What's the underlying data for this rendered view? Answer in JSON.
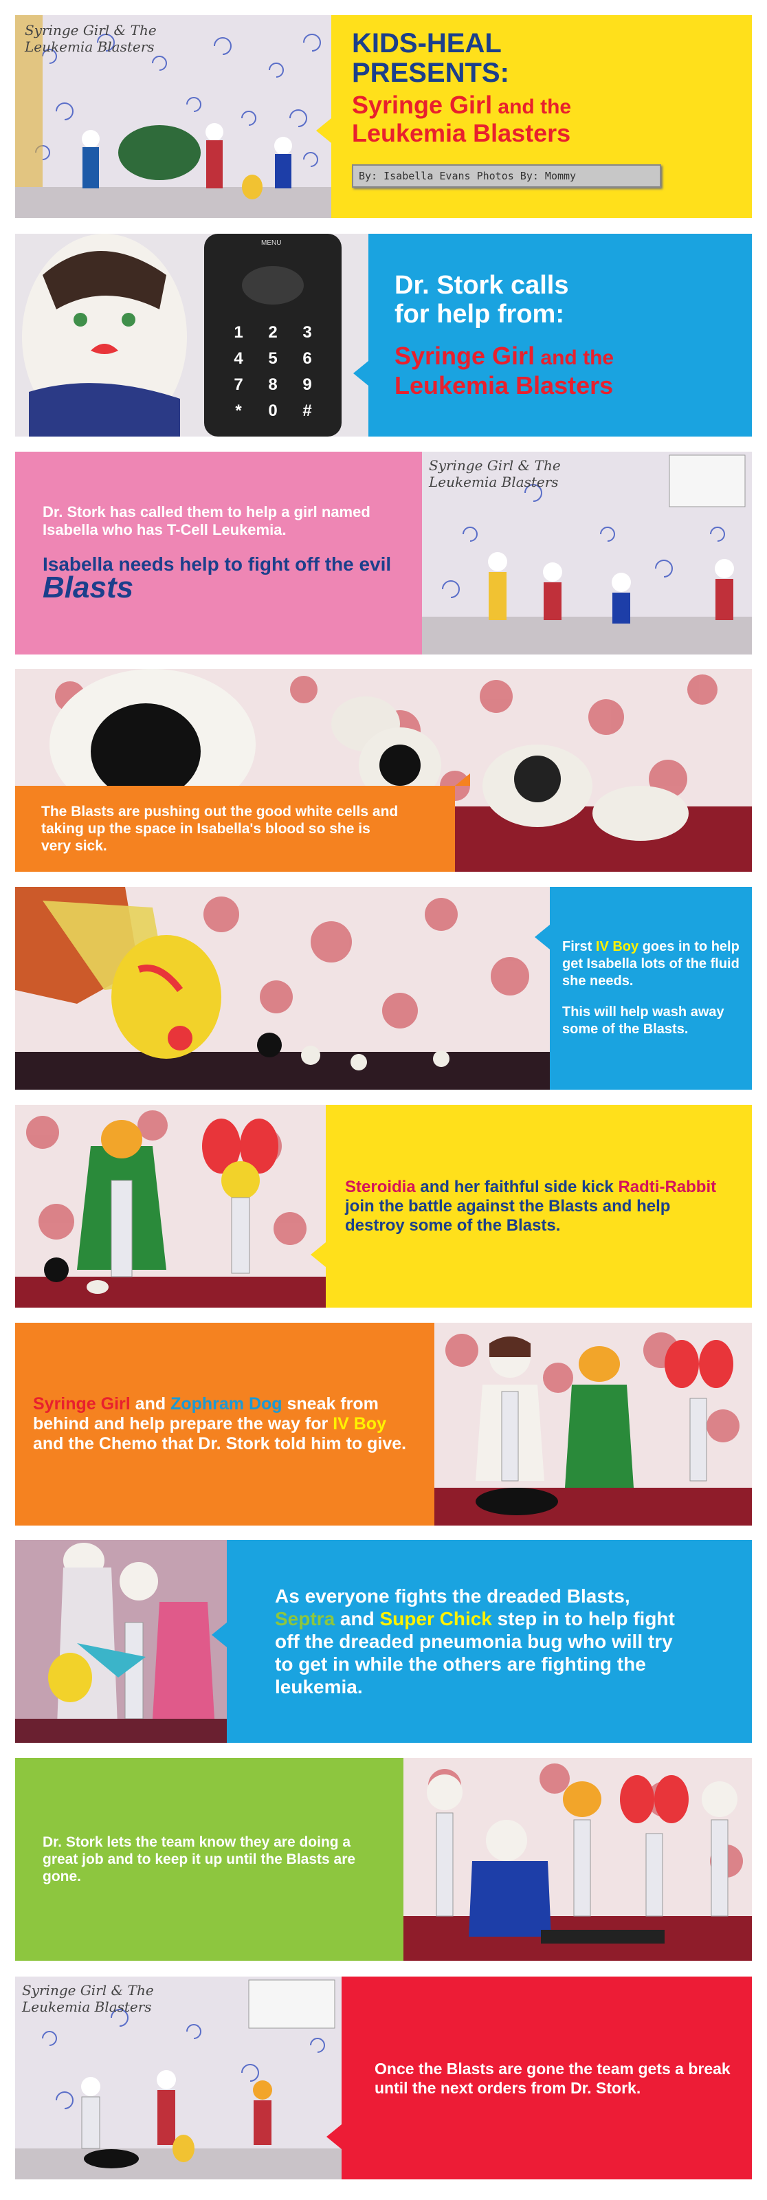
{
  "colors": {
    "yellow": "#ffe01b",
    "blue": "#1aa3e0",
    "pink": "#ee86b4",
    "orange": "#f58220",
    "green": "#8dc63f",
    "red": "#ed1c36",
    "navy": "#1b3f8b"
  },
  "panel1": {
    "title_line1": "KIDS-HEAL",
    "title_line2": "PRESENTS:",
    "subtitle_a": "Syringe Girl",
    "subtitle_b": " and the",
    "subtitle_c": "Leukemia Blasters",
    "byline": "By: Isabella Evans Photos By: Mommy",
    "photo_text": "Syringe Girl & The Leukemia Blasters"
  },
  "panel2": {
    "line1": "Dr. Stork calls",
    "line2": "for help from:",
    "name_a": "Syringe Girl",
    "name_b": " and the",
    "name_c": "Leukemia Blasters",
    "phone_menu": "MENU",
    "phone_keys": [
      "1",
      "2",
      "3",
      "4",
      "5",
      "6",
      "7",
      "8",
      "9",
      "*",
      "0",
      "#"
    ]
  },
  "panel3": {
    "text": "Dr. Stork has called them to help a girl named Isabella who has T-Cell Leukemia.",
    "text2": "Isabella needs help to fight off the evil",
    "blasts": "Blasts",
    "photo_text": "Syringe Girl & The Leukemia Blasters"
  },
  "panel4": {
    "text": "The Blasts are pushing out the good white cells and taking up the space in Isabella's blood so she is very sick."
  },
  "panel5": {
    "text_a": "First ",
    "text_hl": "IV Boy",
    "text_b": " goes in to help get Isabella lots of the fluid she needs.",
    "text2": "This will help wash away some of the Blasts."
  },
  "panel6": {
    "hl1": "Steroidia",
    "text_a": " and her faithful side kick ",
    "hl2": "Radti-Rabbit",
    "text_b": " join the battle against the Blasts and help destroy some of the Blasts."
  },
  "panel7": {
    "hl1": "Syringe Girl",
    "text_a": " and ",
    "hl2": "Zophram Dog",
    "text_b": " sneak from behind and help prepare the way for ",
    "hl3": "IV Boy",
    "text_c": " and the Chemo that Dr. Stork told him to give."
  },
  "panel8": {
    "text_a": "As everyone fights the dreaded Blasts, ",
    "hl1": "Septra",
    "text_b": " and ",
    "hl2": "Super Chick",
    "text_c": " step in to help fight off the dreaded pneumonia bug who will try to get in while the others are fighting the leukemia."
  },
  "panel9": {
    "text": "Dr. Stork lets the team know they are doing a great job and to keep it up until the Blasts are gone."
  },
  "panel10": {
    "text": "Once the Blasts are gone the team gets a break until the next orders from Dr. Stork.",
    "photo_text": "Syringe Girl & The Leukemia Blasters"
  }
}
